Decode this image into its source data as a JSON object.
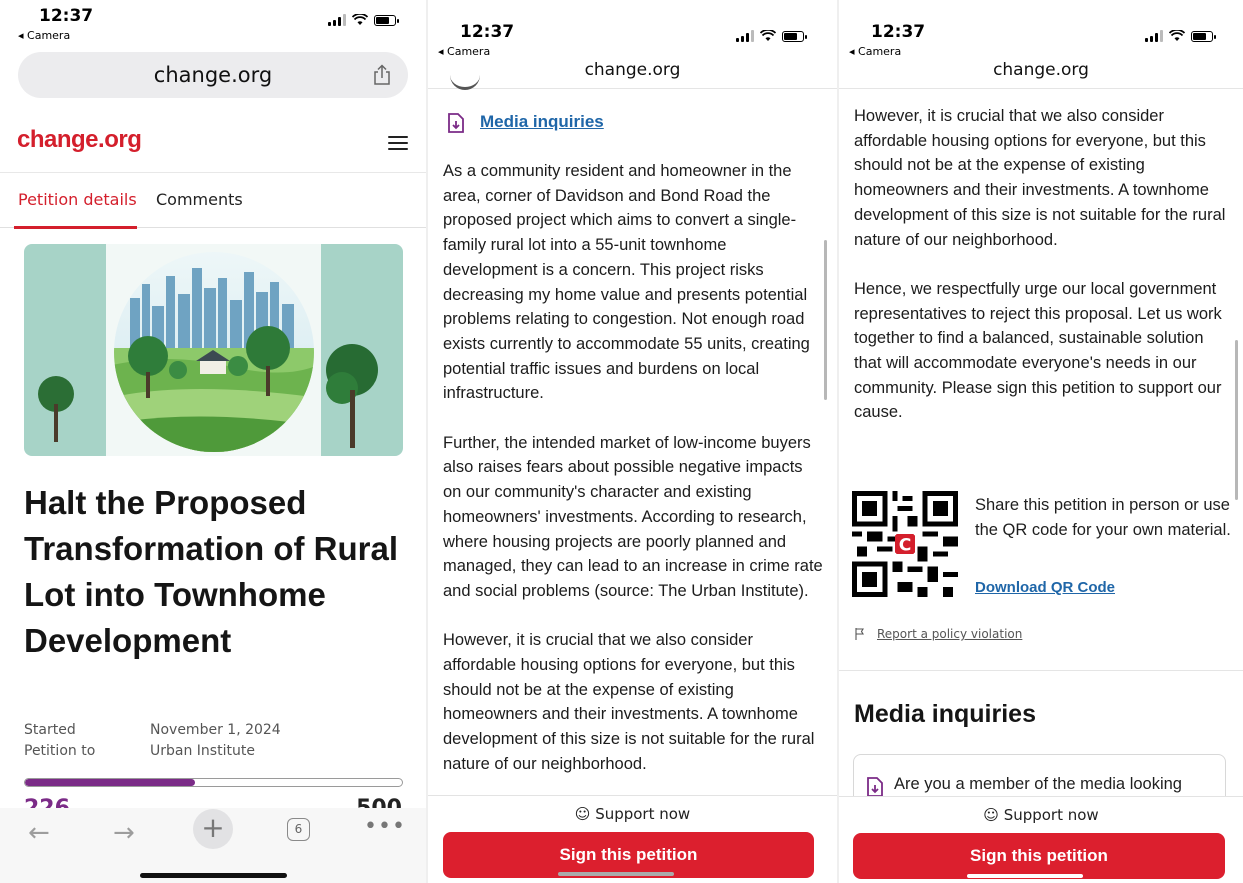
{
  "status": {
    "time": "12:37",
    "back_app": "◂ Camera"
  },
  "browser": {
    "url": "change.org",
    "tab_count": "6"
  },
  "brand": {
    "logo": "change.org",
    "color": "#d41f2c"
  },
  "tabs": [
    {
      "label": "Petition details",
      "active": true
    },
    {
      "label": "Comments",
      "active": false
    }
  ],
  "petition": {
    "title": "Halt the Proposed Transformation of Rural Lot into Townhome Development",
    "started_label": "Started",
    "started_value": "November 1, 2024",
    "petition_to_label": "Petition to",
    "petition_to_value": "Urban Institute",
    "signatures": "226",
    "goal": "500",
    "progress_fraction": 0.45
  },
  "body": {
    "media_link": "Media inquiries",
    "paragraphs": [
      "As a community resident and homeowner in the area, corner of Davidson and Bond Road the proposed project which aims to convert a single-family rural lot into a 55-unit townhome development is a concern. This project risks decreasing my home value and presents potential problems relating to congestion. Not enough road exists currently to accommodate 55 units, creating potential traffic issues and burdens on local infrastructure.",
      "Further, the intended market of low-income buyers also raises fears about possible negative impacts on our community's character and existing homeowners' investments. According to research, where housing projects are poorly planned and managed, they can lead to an increase in crime rate and social problems (source: The Urban Institute).",
      "However, it is crucial that we also consider affordable housing options for everyone, but this should not be at the expense of existing homeowners and their investments. A townhome development of this size is not suitable for the rural nature of our neighborhood.",
      "Hence, we respectfully urge our local government representatives to reject this proposal. Let us work together to find a balanced, sustainable solution that will accommodate everyone's needs in our community. Please sign this petition to support our cause."
    ]
  },
  "share": {
    "text": "Share this petition in person or use the QR code for your own material.",
    "download_label": "Download QR Code"
  },
  "report_label": "Report a policy violation",
  "media": {
    "title": "Media inquiries",
    "card_text": "Are you a member of the media looking"
  },
  "cta": {
    "support_label": "Support now",
    "sign_label": "Sign this petition",
    "color": "#dc1f2e"
  }
}
